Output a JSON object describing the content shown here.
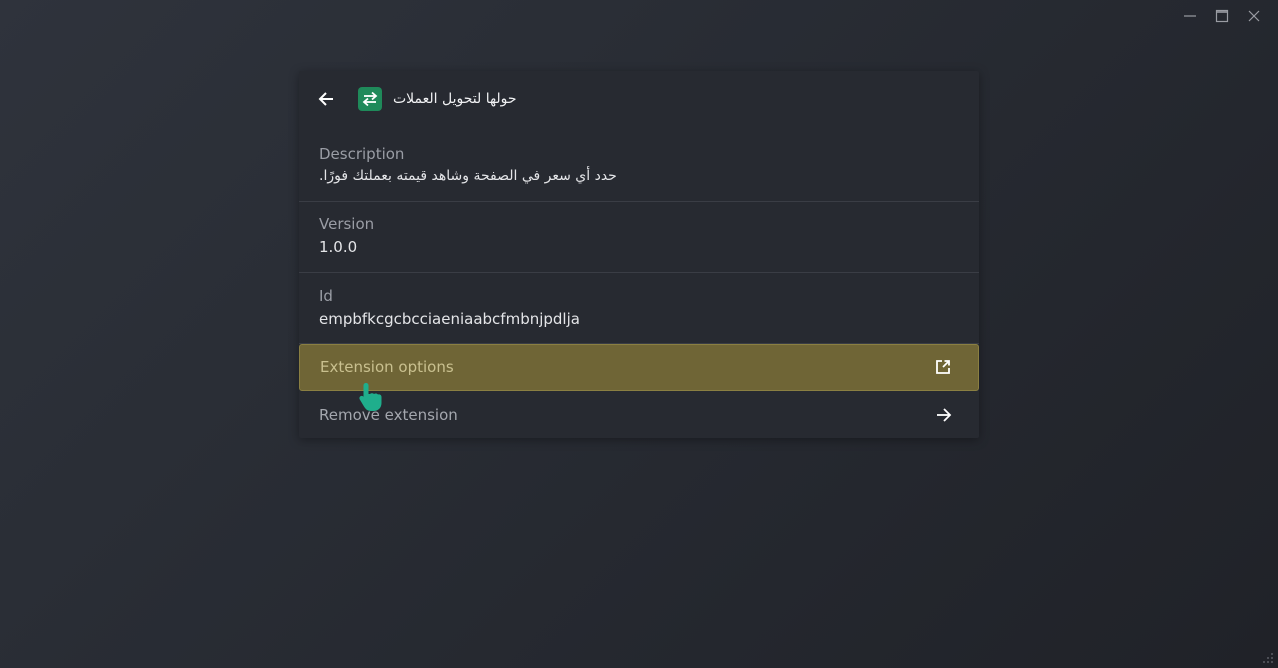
{
  "window": {
    "controls": {
      "minimize_icon": "minimize-icon",
      "maximize_icon": "maximize-icon",
      "close_icon": "close-icon"
    }
  },
  "header": {
    "back_icon": "back-arrow-icon",
    "app_icon": "swap-arrows-icon",
    "app_icon_color": "#1f8a5a",
    "title": "حولها لتحويل العملات"
  },
  "details": {
    "description": {
      "label": "Description",
      "value": "حدد أي سعر في الصفحة وشاهد قيمته بعملتك فورًا."
    },
    "version": {
      "label": "Version",
      "value": "1.0.0"
    },
    "id": {
      "label": "Id",
      "value": "empbfkcgcbcciaeniaabcfmbnjpdlja"
    }
  },
  "actions": {
    "extension_options": {
      "label": "Extension options",
      "icon": "external-link-icon",
      "highlight_color": "#6f6536"
    },
    "remove_extension": {
      "label": "Remove extension",
      "icon": "arrow-right-icon"
    }
  }
}
